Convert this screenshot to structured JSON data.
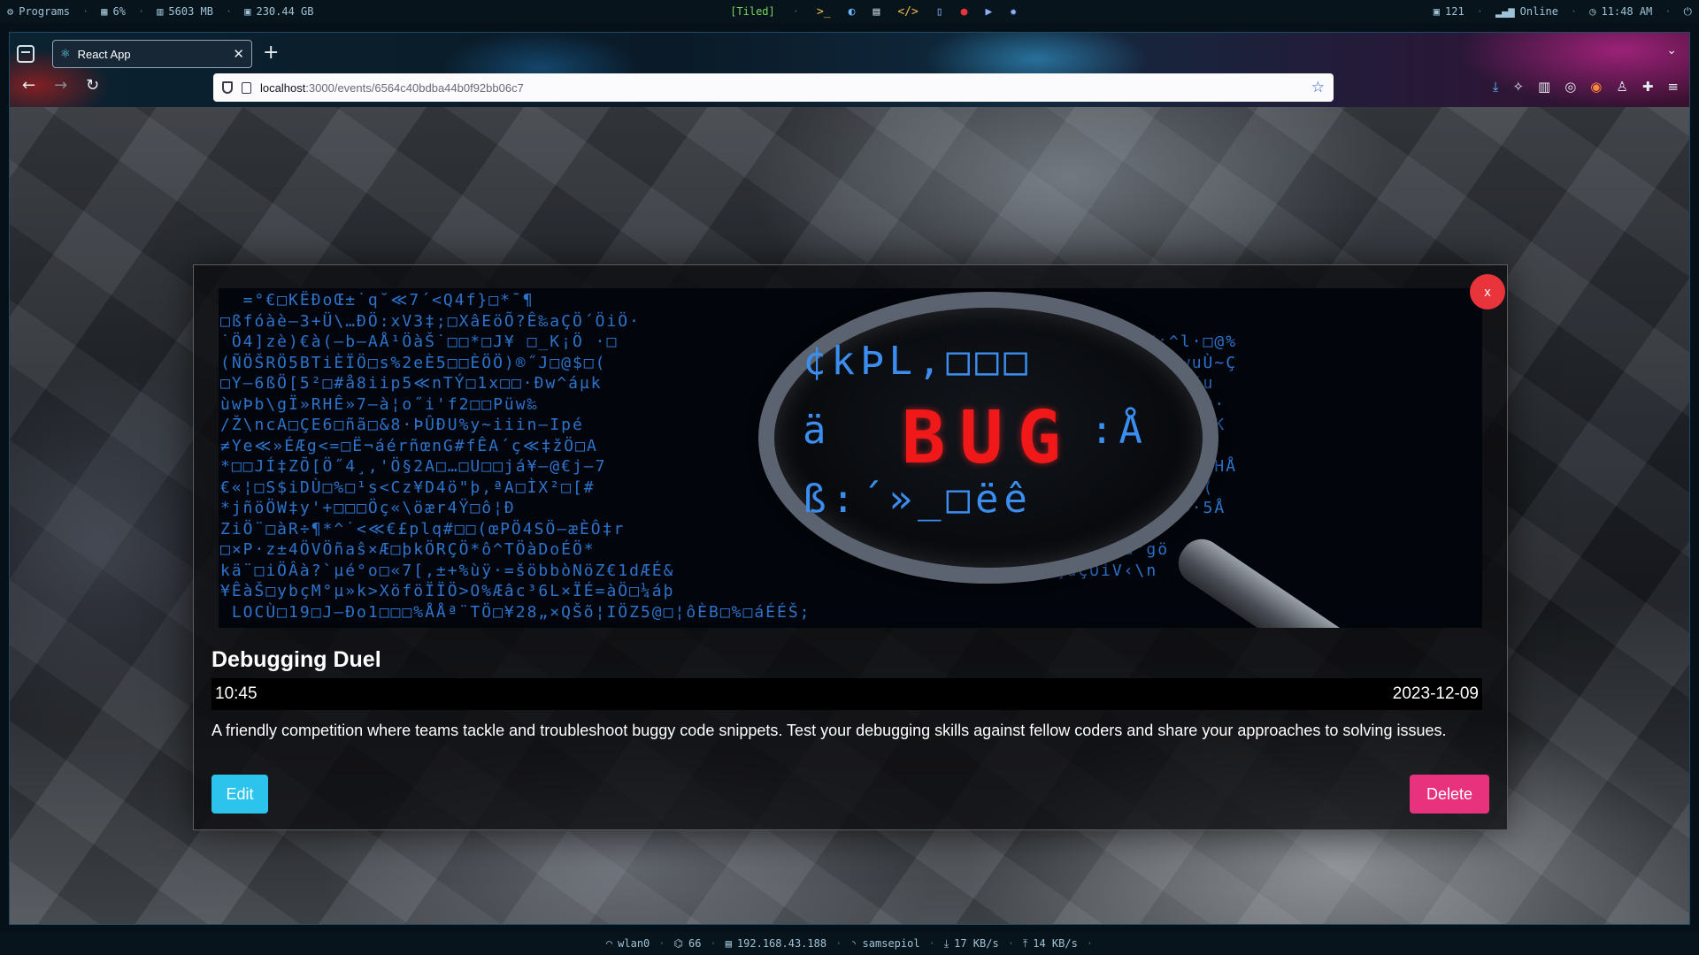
{
  "sysbar": {
    "programs": "Programs",
    "cpu": "6%",
    "memory": "5603 MB",
    "disk": "230.44 GB",
    "layout": "[Tiled]",
    "updates": "121",
    "network_status": "Online",
    "clock": "11:48 AM"
  },
  "browser": {
    "tab_title": "React App",
    "url_host": "localhost",
    "url_rest": ":3000/events/6564c40bdba44b0f92bb06c7"
  },
  "event": {
    "close_label": "x",
    "image_word": "BUG",
    "title": "Debugging Duel",
    "time": "10:45",
    "date": "2023-12-09",
    "description": "A friendly competition where teams tackle and troubleshoot buggy code snippets. Test your debugging skills against fellow coders and share your approaches to solving issues.",
    "edit_label": "Edit",
    "delete_label": "Delete"
  },
  "statusbar": {
    "interface": "wlan0",
    "signal": "66",
    "ip": "192.168.43.188",
    "ssid": "samsepiol",
    "download": "17 KB/s",
    "upload": "14 KB/s"
  }
}
